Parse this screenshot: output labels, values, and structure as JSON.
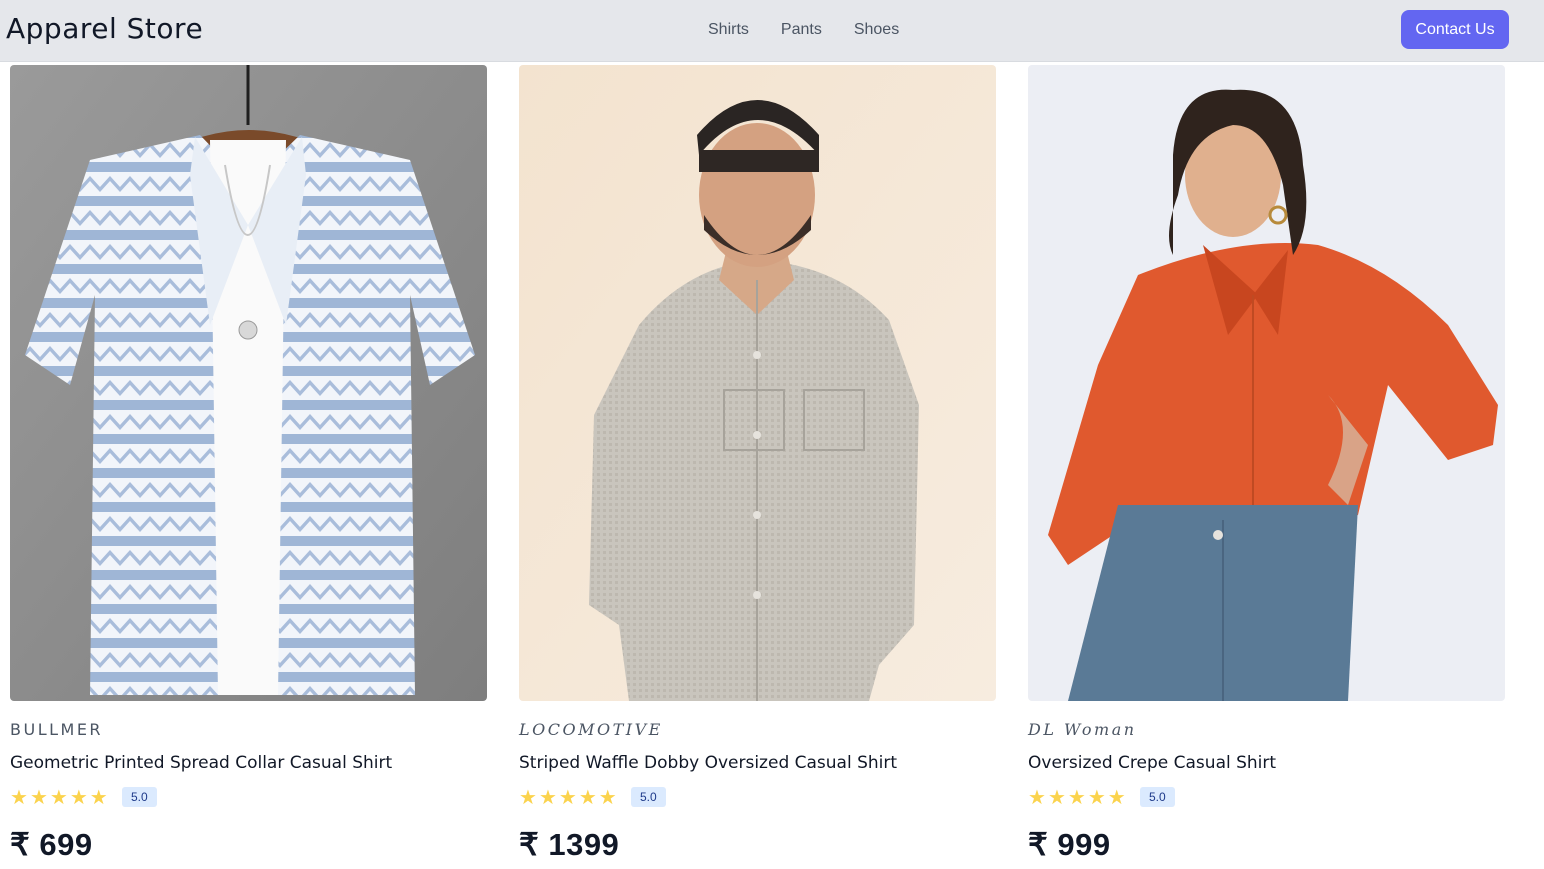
{
  "header": {
    "brand": "Apparel Store",
    "nav": [
      {
        "label": "Shirts"
      },
      {
        "label": "Pants"
      },
      {
        "label": "Shoes"
      }
    ],
    "contact_label": "Contact Us"
  },
  "products": [
    {
      "brand": "BULLMER",
      "title": "Geometric Printed Spread Collar Casual Shirt",
      "stars": "★★★★★",
      "rating": "5.0",
      "price": "₹ 699",
      "image_icon": "patterned-shirt-image",
      "image_bg": "#8f8f8f"
    },
    {
      "brand": "LOCOMOTIVE",
      "title": "Striped Waffle Dobby Oversized Casual Shirt",
      "stars": "★★★★★",
      "rating": "5.0",
      "price": "₹ 1399",
      "image_icon": "man-grey-shirt-image",
      "image_bg": "#f3e2ce"
    },
    {
      "brand": "DL Woman",
      "title": "Oversized Crepe Casual Shirt",
      "stars": "★★★★★",
      "rating": "5.0",
      "price": "₹ 999",
      "image_icon": "woman-orange-shirt-image",
      "image_bg": "#eceef4"
    }
  ],
  "colors": {
    "accent": "#6366f1",
    "navbar_bg": "#e5e7eb",
    "star": "#fbd34d",
    "badge_bg": "#dbeafe"
  }
}
